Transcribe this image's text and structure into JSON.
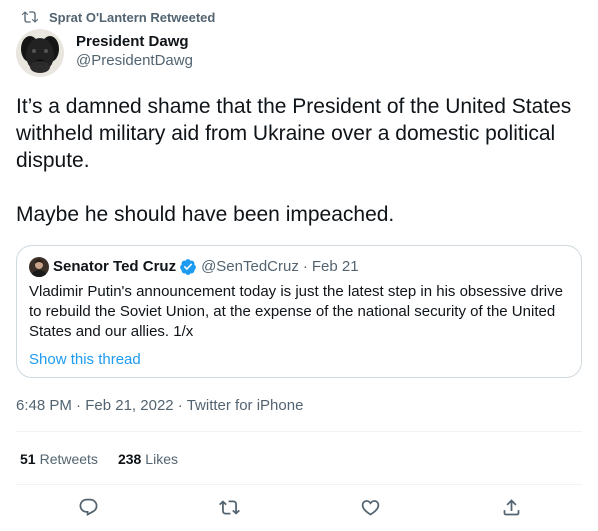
{
  "retweet_context": {
    "label": "Sprat O'Lantern Retweeted",
    "icon": "retweet-icon"
  },
  "author": {
    "name": "President Dawg",
    "handle": "@PresidentDawg",
    "avatar": "dog-avatar"
  },
  "tweet": {
    "paragraphs": [
      "It’s a damned shame that the President of the United States withheld military aid from Ukraine over a domestic political dispute.",
      "Maybe he should have been impeached."
    ]
  },
  "quote": {
    "author_name": "Senator Ted Cruz",
    "verified": true,
    "handle": "@SenTedCruz",
    "separator": "·",
    "date": "Feb 21",
    "text": "Vladimir Putin's announcement today is just the latest step in his obsessive drive to rebuild the Soviet Union, at the expense of the national security of the United States and our allies. 1/x",
    "thread_link": "Show this thread"
  },
  "meta": {
    "time": "6:48 PM",
    "date": "Feb 21, 2022",
    "source": "Twitter for iPhone",
    "separator": "·"
  },
  "stats": {
    "retweets_count": "51",
    "retweets_label": "Retweets",
    "likes_count": "238",
    "likes_label": "Likes"
  },
  "actions": [
    {
      "name": "reply",
      "icon": "reply-icon"
    },
    {
      "name": "retweet",
      "icon": "retweet-icon"
    },
    {
      "name": "like",
      "icon": "heart-icon"
    },
    {
      "name": "share",
      "icon": "share-icon"
    }
  ],
  "colors": {
    "text": "#0f1419",
    "secondary": "#536471",
    "accent": "#1d9bf0",
    "border": "#cfd9de",
    "divider": "#eff3f4"
  }
}
